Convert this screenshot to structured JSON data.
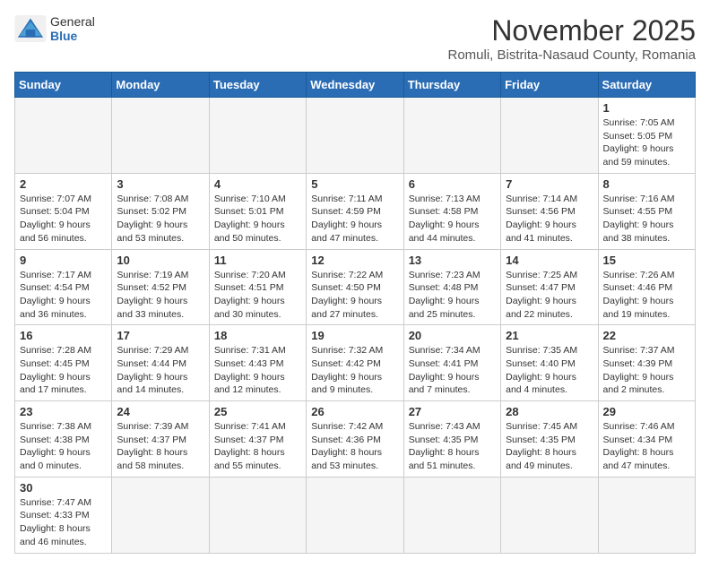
{
  "header": {
    "logo_general": "General",
    "logo_blue": "Blue",
    "month_title": "November 2025",
    "location": "Romuli, Bistrita-Nasaud County, Romania"
  },
  "weekdays": [
    "Sunday",
    "Monday",
    "Tuesday",
    "Wednesday",
    "Thursday",
    "Friday",
    "Saturday"
  ],
  "weeks": [
    [
      {
        "day": "",
        "info": ""
      },
      {
        "day": "",
        "info": ""
      },
      {
        "day": "",
        "info": ""
      },
      {
        "day": "",
        "info": ""
      },
      {
        "day": "",
        "info": ""
      },
      {
        "day": "",
        "info": ""
      },
      {
        "day": "1",
        "info": "Sunrise: 7:05 AM\nSunset: 5:05 PM\nDaylight: 9 hours\nand 59 minutes."
      }
    ],
    [
      {
        "day": "2",
        "info": "Sunrise: 7:07 AM\nSunset: 5:04 PM\nDaylight: 9 hours\nand 56 minutes."
      },
      {
        "day": "3",
        "info": "Sunrise: 7:08 AM\nSunset: 5:02 PM\nDaylight: 9 hours\nand 53 minutes."
      },
      {
        "day": "4",
        "info": "Sunrise: 7:10 AM\nSunset: 5:01 PM\nDaylight: 9 hours\nand 50 minutes."
      },
      {
        "day": "5",
        "info": "Sunrise: 7:11 AM\nSunset: 4:59 PM\nDaylight: 9 hours\nand 47 minutes."
      },
      {
        "day": "6",
        "info": "Sunrise: 7:13 AM\nSunset: 4:58 PM\nDaylight: 9 hours\nand 44 minutes."
      },
      {
        "day": "7",
        "info": "Sunrise: 7:14 AM\nSunset: 4:56 PM\nDaylight: 9 hours\nand 41 minutes."
      },
      {
        "day": "8",
        "info": "Sunrise: 7:16 AM\nSunset: 4:55 PM\nDaylight: 9 hours\nand 38 minutes."
      }
    ],
    [
      {
        "day": "9",
        "info": "Sunrise: 7:17 AM\nSunset: 4:54 PM\nDaylight: 9 hours\nand 36 minutes."
      },
      {
        "day": "10",
        "info": "Sunrise: 7:19 AM\nSunset: 4:52 PM\nDaylight: 9 hours\nand 33 minutes."
      },
      {
        "day": "11",
        "info": "Sunrise: 7:20 AM\nSunset: 4:51 PM\nDaylight: 9 hours\nand 30 minutes."
      },
      {
        "day": "12",
        "info": "Sunrise: 7:22 AM\nSunset: 4:50 PM\nDaylight: 9 hours\nand 27 minutes."
      },
      {
        "day": "13",
        "info": "Sunrise: 7:23 AM\nSunset: 4:48 PM\nDaylight: 9 hours\nand 25 minutes."
      },
      {
        "day": "14",
        "info": "Sunrise: 7:25 AM\nSunset: 4:47 PM\nDaylight: 9 hours\nand 22 minutes."
      },
      {
        "day": "15",
        "info": "Sunrise: 7:26 AM\nSunset: 4:46 PM\nDaylight: 9 hours\nand 19 minutes."
      }
    ],
    [
      {
        "day": "16",
        "info": "Sunrise: 7:28 AM\nSunset: 4:45 PM\nDaylight: 9 hours\nand 17 minutes."
      },
      {
        "day": "17",
        "info": "Sunrise: 7:29 AM\nSunset: 4:44 PM\nDaylight: 9 hours\nand 14 minutes."
      },
      {
        "day": "18",
        "info": "Sunrise: 7:31 AM\nSunset: 4:43 PM\nDaylight: 9 hours\nand 12 minutes."
      },
      {
        "day": "19",
        "info": "Sunrise: 7:32 AM\nSunset: 4:42 PM\nDaylight: 9 hours\nand 9 minutes."
      },
      {
        "day": "20",
        "info": "Sunrise: 7:34 AM\nSunset: 4:41 PM\nDaylight: 9 hours\nand 7 minutes."
      },
      {
        "day": "21",
        "info": "Sunrise: 7:35 AM\nSunset: 4:40 PM\nDaylight: 9 hours\nand 4 minutes."
      },
      {
        "day": "22",
        "info": "Sunrise: 7:37 AM\nSunset: 4:39 PM\nDaylight: 9 hours\nand 2 minutes."
      }
    ],
    [
      {
        "day": "23",
        "info": "Sunrise: 7:38 AM\nSunset: 4:38 PM\nDaylight: 9 hours\nand 0 minutes."
      },
      {
        "day": "24",
        "info": "Sunrise: 7:39 AM\nSunset: 4:37 PM\nDaylight: 8 hours\nand 58 minutes."
      },
      {
        "day": "25",
        "info": "Sunrise: 7:41 AM\nSunset: 4:37 PM\nDaylight: 8 hours\nand 55 minutes."
      },
      {
        "day": "26",
        "info": "Sunrise: 7:42 AM\nSunset: 4:36 PM\nDaylight: 8 hours\nand 53 minutes."
      },
      {
        "day": "27",
        "info": "Sunrise: 7:43 AM\nSunset: 4:35 PM\nDaylight: 8 hours\nand 51 minutes."
      },
      {
        "day": "28",
        "info": "Sunrise: 7:45 AM\nSunset: 4:35 PM\nDaylight: 8 hours\nand 49 minutes."
      },
      {
        "day": "29",
        "info": "Sunrise: 7:46 AM\nSunset: 4:34 PM\nDaylight: 8 hours\nand 47 minutes."
      }
    ],
    [
      {
        "day": "30",
        "info": "Sunrise: 7:47 AM\nSunset: 4:33 PM\nDaylight: 8 hours\nand 46 minutes."
      },
      {
        "day": "",
        "info": ""
      },
      {
        "day": "",
        "info": ""
      },
      {
        "day": "",
        "info": ""
      },
      {
        "day": "",
        "info": ""
      },
      {
        "day": "",
        "info": ""
      },
      {
        "day": "",
        "info": ""
      }
    ]
  ]
}
